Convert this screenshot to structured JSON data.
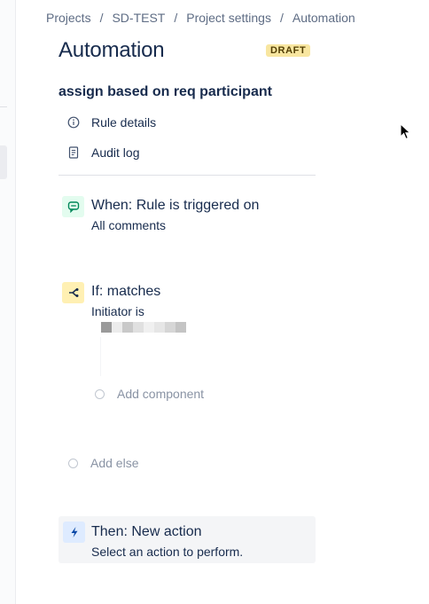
{
  "breadcrumb": {
    "items": [
      "Projects",
      "SD-TEST",
      "Project settings",
      "Automation"
    ],
    "separator": "/"
  },
  "page": {
    "title": "Automation",
    "status_badge": "DRAFT"
  },
  "rule": {
    "name": "assign based on req participant",
    "menu": {
      "details_label": "Rule details",
      "details_icon": "info-icon",
      "audit_label": "Audit log",
      "audit_icon": "document-icon"
    }
  },
  "trigger": {
    "heading": "When: Rule is triggered on",
    "detail": "All comments",
    "icon": "comment-icon"
  },
  "condition": {
    "heading": "If: matches",
    "detail": "Initiator is",
    "icon": "branch-icon"
  },
  "add_component_label": "Add component",
  "add_else_label": "Add else",
  "action": {
    "heading": "Then: New action",
    "detail": "Select an action to perform.",
    "icon": "lightning-icon"
  },
  "colors": {
    "trigger_badge": "#e3fcef",
    "condition_badge": "#fff0b3",
    "action_badge": "#deebff",
    "draft_badge": "#f8e6a0"
  }
}
